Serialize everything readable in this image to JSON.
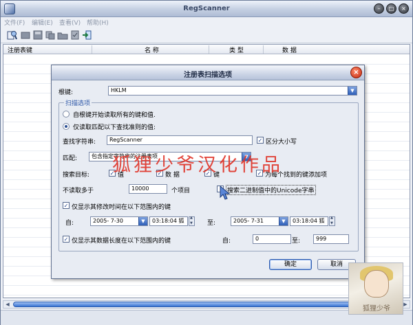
{
  "window": {
    "title": "RegScanner"
  },
  "menu": [
    "文件(F)",
    "编辑(E)",
    "查看(V)",
    "帮助(H)"
  ],
  "list": {
    "columns": [
      "注册表键",
      "名 称",
      "类 型",
      "数 据"
    ]
  },
  "dialog": {
    "title": "注册表扫描选项",
    "root_label": "根键:",
    "root_value": "HKLM",
    "group_title": "扫描选项",
    "radio_all": "自根键开始读取所有的键和值.",
    "radio_match": "仅读取匹配以下查找准则的值:",
    "find_label": "查找字符串:",
    "find_value": "RegScanner",
    "case_label": "区分大小写",
    "match_label": "匹配:",
    "match_value": "包含指定字符串的注册表项",
    "target_label": "搜索目标:",
    "target_value": "值",
    "target_data": "数 据",
    "target_key": "键",
    "add_key_label": "为每个找到的键添加项",
    "limit_label": "不读取多于",
    "limit_value": "10000",
    "limit_unit": "个项目",
    "unicode_label": "搜索二进制值中的Unicode字串",
    "date_check_label": "仅显示其修改时间在以下范围内的键",
    "from_label": "自:",
    "from_date": "2005- 7-30",
    "from_time": "03:18:04 狐",
    "to_label": "至:",
    "to_date": "2005- 7-31",
    "to_time": "03:18:04 狐",
    "length_check_label": "仅显示其数据长度在以下范围内的键",
    "len_from_label": "自:",
    "len_from": "0",
    "len_to_label": "至:",
    "len_to": "999",
    "ok": "确定",
    "cancel": "取消"
  },
  "watermark": "狐狸少爷汉化作品",
  "avatar_caption": "狐狸少爷",
  "colors": {
    "accent": "#2e5fb8",
    "watermark": "#e0352a"
  }
}
